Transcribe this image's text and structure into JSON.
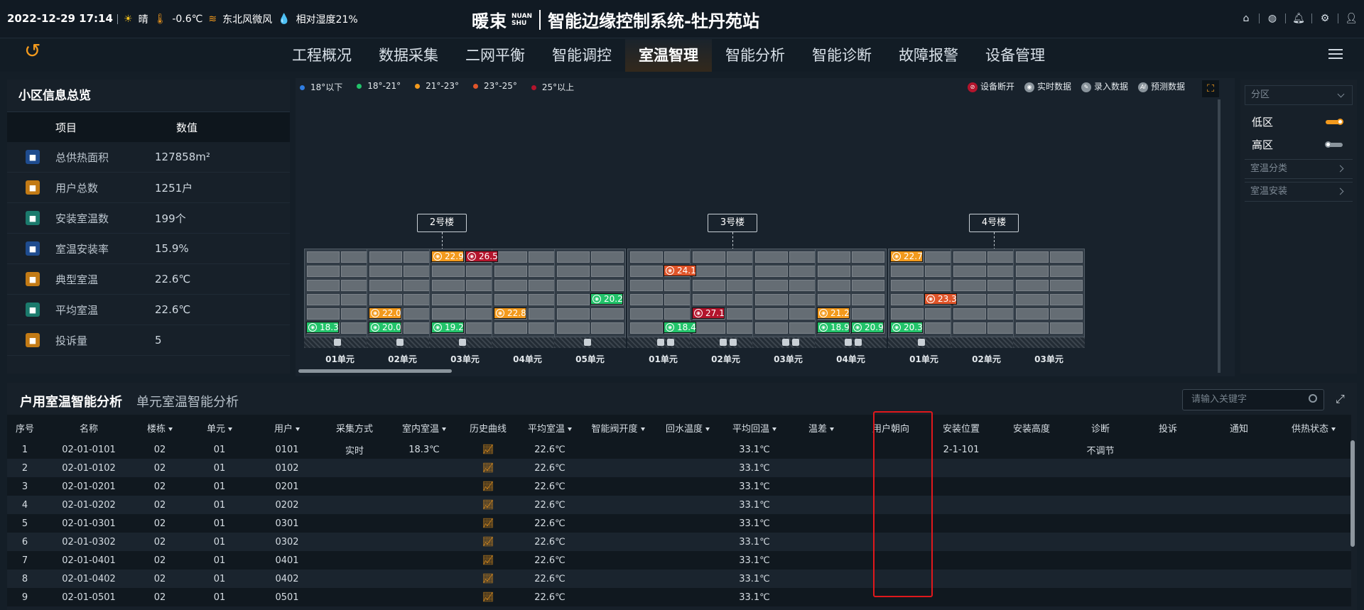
{
  "header": {
    "datetime": "2022-12-29 17:14",
    "weather": "晴",
    "temp": "-0.6℃",
    "wind": "东北风微风",
    "humidity": "相对湿度21%",
    "brand_cn": "暖束",
    "brand_en1": "NUAN",
    "brand_en2": "SHU",
    "system_title": "智能边缘控制系统-牡丹苑站",
    "icons": [
      "home-icon",
      "globe-icon",
      "bell-icon",
      "gear-icon",
      "user-icon"
    ]
  },
  "nav": {
    "tabs": [
      "工程概况",
      "数据采集",
      "二网平衡",
      "智能调控",
      "室温智理",
      "智能分析",
      "智能诊断",
      "故障报警",
      "设备管理"
    ],
    "active": "室温智理"
  },
  "left": {
    "title": "小区信息总览",
    "col_item": "项目",
    "col_value": "数值",
    "rows": [
      {
        "name": "总供热面积",
        "value": "127858m²",
        "icon": "area-icon",
        "color": "#1f4c8f"
      },
      {
        "name": "用户总数",
        "value": "1251户",
        "icon": "lock-icon",
        "color": "#c27a15"
      },
      {
        "name": "安装室温数",
        "value": "199个",
        "icon": "house-icon",
        "color": "#1b7a6c"
      },
      {
        "name": "室温安装率",
        "value": "15.9%",
        "icon": "house-rate-icon",
        "color": "#1f4c8f"
      },
      {
        "name": "典型室温",
        "value": "22.6℃",
        "icon": "typical-icon",
        "color": "#c27a15"
      },
      {
        "name": "平均室温",
        "value": "22.6℃",
        "icon": "average-icon",
        "color": "#1b7a6c"
      },
      {
        "name": "投诉量",
        "value": "5",
        "icon": "complaint-icon",
        "color": "#c27a15"
      }
    ]
  },
  "center": {
    "legend": [
      {
        "label": "18°以下",
        "color": "#2f7de1"
      },
      {
        "label": "18°-21°",
        "color": "#22c36a"
      },
      {
        "label": "21°-23°",
        "color": "#f39a1d"
      },
      {
        "label": "23°-25°",
        "color": "#e0552a"
      },
      {
        "label": "25°以上",
        "color": "#b3142c"
      }
    ],
    "status_legend": [
      {
        "label": "设备断开",
        "color": "#b3142c",
        "glyph": "⊘"
      },
      {
        "label": "实时数据",
        "color": "#8a949c",
        "glyph": "◉"
      },
      {
        "label": "录入数据",
        "color": "#8a949c",
        "glyph": "✎"
      },
      {
        "label": "预测数据",
        "color": "#8a949c",
        "glyph": "AI"
      }
    ],
    "buildings": [
      "2号楼",
      "3号楼",
      "4号楼"
    ],
    "units": [
      "01单元",
      "02单元",
      "03单元",
      "04单元",
      "05单元",
      "01单元",
      "02单元",
      "03单元",
      "04单元",
      "01单元",
      "02单元",
      "03单元"
    ],
    "readings": [
      {
        "unit": 0,
        "row": 5,
        "col": 0,
        "value": "18.3",
        "color": "#22c36a"
      },
      {
        "unit": 1,
        "row": 4,
        "col": 0,
        "value": "22.0",
        "color": "#f39a1d"
      },
      {
        "unit": 1,
        "row": 5,
        "col": 0,
        "value": "20.0",
        "color": "#22c36a"
      },
      {
        "unit": 2,
        "row": 0,
        "col": 0,
        "value": "22.9",
        "color": "#f39a1d"
      },
      {
        "unit": 2,
        "row": 0,
        "col": 1,
        "value": "26.5",
        "color": "#b3142c"
      },
      {
        "unit": 2,
        "row": 5,
        "col": 0,
        "value": "19.2",
        "color": "#22c36a"
      },
      {
        "unit": 3,
        "row": 4,
        "col": 0,
        "value": "22.8",
        "color": "#f39a1d"
      },
      {
        "unit": 4,
        "row": 3,
        "col": 1,
        "value": "20.2",
        "color": "#22c36a"
      },
      {
        "unit": 5,
        "row": 1,
        "col": 1,
        "value": "24.1",
        "color": "#e0552a"
      },
      {
        "unit": 5,
        "row": 5,
        "col": 1,
        "value": "18.4",
        "color": "#22c36a"
      },
      {
        "unit": 6,
        "row": 4,
        "col": 0,
        "value": "27.1",
        "color": "#b3142c"
      },
      {
        "unit": 8,
        "row": 4,
        "col": 0,
        "value": "21.2",
        "color": "#f39a1d"
      },
      {
        "unit": 8,
        "row": 5,
        "col": 0,
        "value": "18.9",
        "color": "#22c36a"
      },
      {
        "unit": 8,
        "row": 5,
        "col": 1,
        "value": "20.9",
        "color": "#22c36a"
      },
      {
        "unit": 9,
        "row": 0,
        "col": 0,
        "value": "22.7",
        "color": "#f39a1d"
      },
      {
        "unit": 9,
        "row": 3,
        "col": 1,
        "value": "23.3",
        "color": "#e0552a"
      },
      {
        "unit": 9,
        "row": 5,
        "col": 0,
        "value": "20.3",
        "color": "#22c36a"
      }
    ]
  },
  "right": {
    "select": "分区",
    "low": "低区",
    "high": "高区",
    "low_on": true,
    "high_on": false,
    "group1": "室温分类",
    "group2": "室温安装"
  },
  "bottom": {
    "tab_active": "户用室温智能分析",
    "tab_other": "单元室温智能分析",
    "search_placeholder": "请输入关键字",
    "columns": [
      "序号",
      "名称",
      "楼栋",
      "单元",
      "用户",
      "采集方式",
      "室内室温",
      "历史曲线",
      "平均室温",
      "智能阀开度",
      "回水温度",
      "平均回温",
      "温差",
      "用户朝向",
      "安装位置",
      "安装高度",
      "诊断",
      "投诉",
      "通知",
      "供热状态"
    ],
    "sortable": [
      false,
      false,
      true,
      true,
      true,
      false,
      true,
      false,
      true,
      true,
      true,
      true,
      true,
      false,
      false,
      false,
      false,
      false,
      false,
      true
    ],
    "rows": [
      [
        "1",
        "02-01-0101",
        "02",
        "01",
        "0101",
        "实时",
        "18.3℃",
        "chart",
        "22.6℃",
        "",
        "",
        "33.1℃",
        "",
        "",
        "2-1-101",
        "",
        "不调节",
        "",
        "",
        ""
      ],
      [
        "2",
        "02-01-0102",
        "02",
        "01",
        "0102",
        "",
        "",
        "chart",
        "22.6℃",
        "",
        "",
        "33.1℃",
        "",
        "",
        "",
        "",
        "",
        "",
        "",
        ""
      ],
      [
        "3",
        "02-01-0201",
        "02",
        "01",
        "0201",
        "",
        "",
        "chart",
        "22.6℃",
        "",
        "",
        "33.1℃",
        "",
        "",
        "",
        "",
        "",
        "",
        "",
        ""
      ],
      [
        "4",
        "02-01-0202",
        "02",
        "01",
        "0202",
        "",
        "",
        "chart",
        "22.6℃",
        "",
        "",
        "33.1℃",
        "",
        "",
        "",
        "",
        "",
        "",
        "",
        ""
      ],
      [
        "5",
        "02-01-0301",
        "02",
        "01",
        "0301",
        "",
        "",
        "chart",
        "22.6℃",
        "",
        "",
        "33.1℃",
        "",
        "",
        "",
        "",
        "",
        "",
        "",
        ""
      ],
      [
        "6",
        "02-01-0302",
        "02",
        "01",
        "0302",
        "",
        "",
        "chart",
        "22.6℃",
        "",
        "",
        "33.1℃",
        "",
        "",
        "",
        "",
        "",
        "",
        "",
        ""
      ],
      [
        "7",
        "02-01-0401",
        "02",
        "01",
        "0401",
        "",
        "",
        "chart",
        "22.6℃",
        "",
        "",
        "33.1℃",
        "",
        "",
        "",
        "",
        "",
        "",
        "",
        ""
      ],
      [
        "8",
        "02-01-0402",
        "02",
        "01",
        "0402",
        "",
        "",
        "chart",
        "22.6℃",
        "",
        "",
        "33.1℃",
        "",
        "",
        "",
        "",
        "",
        "",
        "",
        ""
      ],
      [
        "9",
        "02-01-0501",
        "02",
        "01",
        "0501",
        "",
        "",
        "chart",
        "22.6℃",
        "",
        "",
        "33.1℃",
        "",
        "",
        "",
        "",
        "",
        "",
        "",
        ""
      ]
    ]
  }
}
